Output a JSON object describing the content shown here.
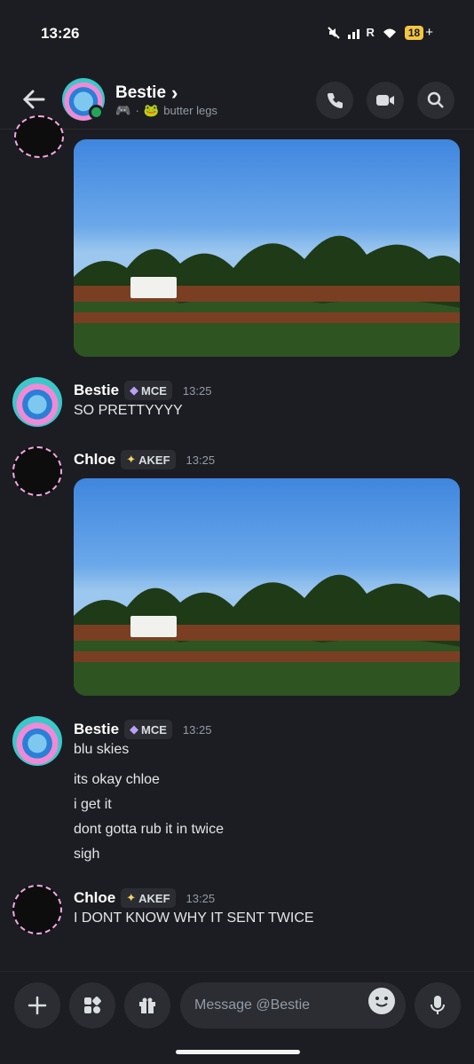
{
  "status_bar": {
    "time": "13:26",
    "battery": "18",
    "battery_suffix": "+",
    "signal_label": "R"
  },
  "header": {
    "title": "Bestie",
    "chevron": "›",
    "status_text": "butter legs",
    "buttons": [
      "call-icon",
      "video-icon",
      "search-icon"
    ]
  },
  "messages": [
    {
      "author": "Bestie",
      "tag": "MCE",
      "time": "13:25",
      "lines": [
        "SO PRETTYYYY"
      ]
    },
    {
      "author": "Chloe",
      "tag": "AKEF",
      "time": "13:25",
      "lines": []
    },
    {
      "author": "Bestie",
      "tag": "MCE",
      "time": "13:25",
      "lines": [
        "blu skies",
        "its okay chloe",
        "i get it",
        "dont gotta rub it in twice",
        "sigh"
      ]
    },
    {
      "author": "Chloe",
      "tag": "AKEF",
      "time": "13:25",
      "lines": [
        "I DONT KNOW WHY IT SENT TWICE"
      ]
    }
  ],
  "composer": {
    "placeholder": "Message @Bestie"
  },
  "colors": {
    "background": "#1c1d22",
    "online": "#23a55a",
    "surface": "#2b2d33"
  }
}
